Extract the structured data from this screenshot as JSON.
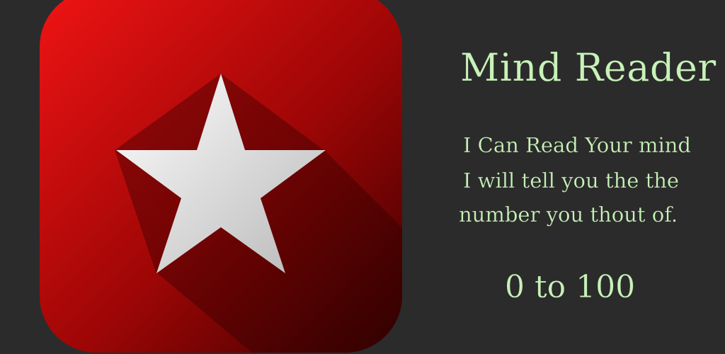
{
  "app": {
    "icon_name": "star-icon",
    "title": "Mind Reader",
    "description_lines": [
      "I Can Read Your mind",
      "I will tell you the the",
      "number you thout of."
    ],
    "range": "0 to 100"
  },
  "colors": {
    "background": "#2b2b2b",
    "icon_red_light": "#f01414",
    "icon_red_dark": "#3a0000",
    "star": "#f2f2f2",
    "text": "#c8f2b8"
  }
}
